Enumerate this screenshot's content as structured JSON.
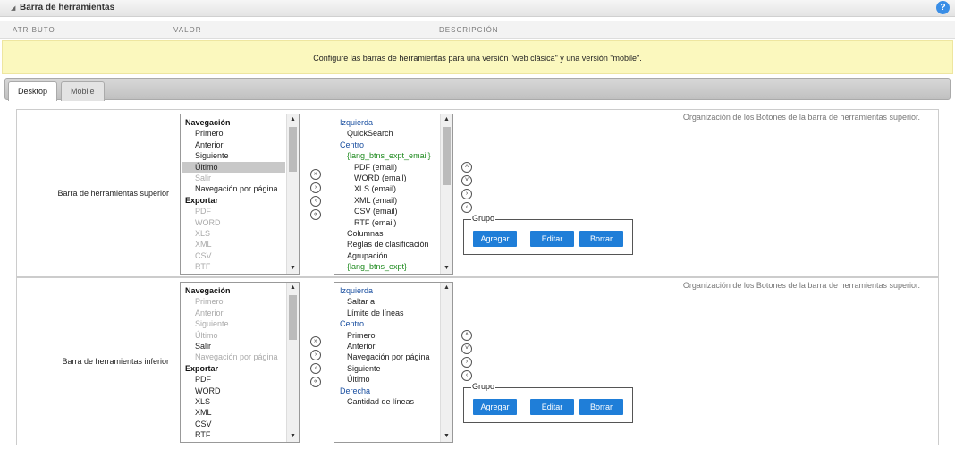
{
  "header": {
    "title": "Barra de herramientas",
    "help_label": "?"
  },
  "columns": {
    "attribute": "ATRIBUTO",
    "value": "VALOR",
    "description": "DESCRIPCIÓN"
  },
  "notice": "Configure las barras de herramientas para una versión \"web clásica\" y una versión \"mobile\".",
  "tabs": [
    {
      "label": "Desktop",
      "active": true
    },
    {
      "label": "Mobile",
      "active": false
    }
  ],
  "rows": [
    {
      "label": "Barra de herramientas superior",
      "note": "Organización de los Botones de la barra de herramientas superior.",
      "available": [
        {
          "text": "Navegación",
          "type": "group"
        },
        {
          "text": "Primero",
          "type": "opt"
        },
        {
          "text": "Anterior",
          "type": "opt"
        },
        {
          "text": "Siguiente",
          "type": "opt"
        },
        {
          "text": "Último",
          "type": "opt",
          "selected": true
        },
        {
          "text": "Salir",
          "type": "opt",
          "disabled": true
        },
        {
          "text": "Navegación por página",
          "type": "opt"
        },
        {
          "text": "Exportar",
          "type": "group"
        },
        {
          "text": "PDF",
          "type": "opt",
          "disabled": true
        },
        {
          "text": "WORD",
          "type": "opt",
          "disabled": true
        },
        {
          "text": "XLS",
          "type": "opt",
          "disabled": true
        },
        {
          "text": "XML",
          "type": "opt",
          "disabled": true
        },
        {
          "text": "CSV",
          "type": "opt",
          "disabled": true
        },
        {
          "text": "RTF",
          "type": "opt",
          "disabled": true
        }
      ],
      "selected_list": [
        {
          "text": "Izquierda",
          "type": "sec"
        },
        {
          "text": "QuickSearch",
          "type": "sec-item"
        },
        {
          "text": "Centro",
          "type": "sec"
        },
        {
          "text": "{lang_btns_expt_email}",
          "type": "sec-item",
          "macro": true
        },
        {
          "text": "PDF (email)",
          "type": "sec-sub"
        },
        {
          "text": "WORD (email)",
          "type": "sec-sub"
        },
        {
          "text": "XLS (email)",
          "type": "sec-sub"
        },
        {
          "text": "XML (email)",
          "type": "sec-sub"
        },
        {
          "text": "CSV (email)",
          "type": "sec-sub"
        },
        {
          "text": "RTF (email)",
          "type": "sec-sub"
        },
        {
          "text": "Columnas",
          "type": "sec-item"
        },
        {
          "text": "Reglas de clasificación",
          "type": "sec-item"
        },
        {
          "text": "Agrupación",
          "type": "sec-item"
        },
        {
          "text": "{lang_btns_expt}",
          "type": "sec-item",
          "macro": true
        }
      ]
    },
    {
      "label": "Barra de herramientas inferior",
      "note": "Organización de los Botones de la barra de herramientas superior.",
      "available": [
        {
          "text": "Navegación",
          "type": "group"
        },
        {
          "text": "Primero",
          "type": "opt",
          "disabled": true
        },
        {
          "text": "Anterior",
          "type": "opt",
          "disabled": true
        },
        {
          "text": "Siguiente",
          "type": "opt",
          "disabled": true
        },
        {
          "text": "Último",
          "type": "opt",
          "disabled": true
        },
        {
          "text": "Salir",
          "type": "opt"
        },
        {
          "text": "Navegación por página",
          "type": "opt",
          "disabled": true
        },
        {
          "text": "Exportar",
          "type": "group"
        },
        {
          "text": "PDF",
          "type": "opt"
        },
        {
          "text": "WORD",
          "type": "opt"
        },
        {
          "text": "XLS",
          "type": "opt"
        },
        {
          "text": "XML",
          "type": "opt"
        },
        {
          "text": "CSV",
          "type": "opt"
        },
        {
          "text": "RTF",
          "type": "opt"
        }
      ],
      "selected_list": [
        {
          "text": "Izquierda",
          "type": "sec"
        },
        {
          "text": "Saltar a",
          "type": "sec-item"
        },
        {
          "text": "Límite de líneas",
          "type": "sec-item"
        },
        {
          "text": "Centro",
          "type": "sec"
        },
        {
          "text": "Primero",
          "type": "sec-item"
        },
        {
          "text": "Anterior",
          "type": "sec-item"
        },
        {
          "text": "Navegación por página",
          "type": "sec-item"
        },
        {
          "text": "Siguiente",
          "type": "sec-item"
        },
        {
          "text": "Último",
          "type": "sec-item"
        },
        {
          "text": "Derecha",
          "type": "sec"
        },
        {
          "text": "Cantidad de líneas",
          "type": "sec-item"
        }
      ]
    }
  ],
  "transfer_icons": [
    "add-all-icon",
    "add-icon",
    "remove-icon",
    "remove-all-icon"
  ],
  "order_icons": [
    "move-up-icon",
    "move-down-icon",
    "move-right-icon",
    "move-left-icon"
  ],
  "group": {
    "legend": "Grupo",
    "buttons": [
      {
        "label": "Agregar"
      },
      {
        "label": "Editar"
      },
      {
        "label": "Borrar"
      }
    ]
  },
  "colors": {
    "accent": "#1f7ed8",
    "section": "#1a4fa0",
    "macro": "#1e8a1e",
    "notice_bg": "#fbf8be"
  }
}
